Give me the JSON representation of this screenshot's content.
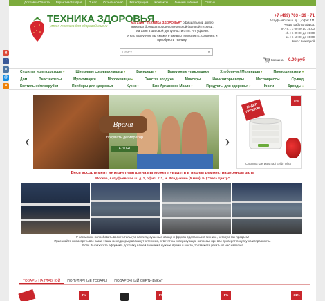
{
  "topnav": [
    "Доставка/Оплата",
    "Гарантия/Возврат",
    "О нас",
    "Отзывы о нас",
    "Регистрация",
    "Контакты",
    "Личный кабинет",
    "Статьи"
  ],
  "brand": {
    "name": "ТЕХНИКА ЗДОРОВЬЯ",
    "tagline": "умная техника для здоровой жизни"
  },
  "header_info": {
    "line1_red": "Магазин \"ТЕХНИКА ЗДОРОВЬЯ\"",
    "line1_rest": " официальный дилер",
    "line2": "мировых брендов профессиональной бытовой техники.",
    "line3": "Магазин в шаговой доступности от м. Алтуфьево.",
    "line4": "У нас в шоуруме вы сможете вживую посмотреть, сравнить и",
    "line5": "приобрести технику."
  },
  "contacts": {
    "phone": "+7 (499) 703 - 39 - 71",
    "address": "Алтуфьевское ш. д. 1, офис 111",
    "hours_title": "Режим работы офиса:",
    "hours": [
      "пн.-пт. : с 09:00 до 19:00",
      "сб. : с 09:00 до 19:00",
      "вс. : с 10:00 до 15:00",
      "вскр.: выходной"
    ]
  },
  "search": {
    "placeholder": "Поиск"
  },
  "cart": {
    "label": "Корзина",
    "price": "0.00 руб"
  },
  "menu_rows": [
    [
      {
        "label": "Сушилки и дегидраторы",
        "drop": true
      },
      {
        "label": "Шнековые соковыжималки",
        "drop": true
      },
      {
        "label": "Блендеры",
        "drop": true
      },
      {
        "label": "Вакуумные упаковщики",
        "drop": false
      },
      {
        "label": "Хлебопечи / Мельницы",
        "drop": true
      },
      {
        "label": "Пророщиватели",
        "drop": true
      }
    ],
    [
      {
        "label": "Дом",
        "drop": false
      },
      {
        "label": "Экостеклеры",
        "drop": false
      },
      {
        "label": "Мультиварки",
        "drop": false
      },
      {
        "label": "Мороженицы",
        "drop": true
      },
      {
        "label": "Очистка воздуха",
        "drop": false
      },
      {
        "label": "Миксеры",
        "drop": false
      },
      {
        "label": "Ионизаторы воды",
        "drop": false
      },
      {
        "label": "Маслопрессы",
        "drop": false
      },
      {
        "label": "Су-вид",
        "drop": false
      }
    ],
    [
      {
        "label": "Коптильни/мясорубки",
        "drop": false
      },
      {
        "label": "Приборы для здоровья",
        "drop": false
      },
      {
        "label": "Кухня",
        "drop": true
      },
      {
        "label": "Био Аргановое Масло",
        "drop": true
      },
      {
        "label": "Продукты для здоровья",
        "drop": true
      },
      {
        "label": "Книги",
        "drop": false
      },
      {
        "label": "Бренды",
        "drop": true
      }
    ]
  ],
  "slider": {
    "title": "Время",
    "subtitle": "покупать дегидратор",
    "brand": "EZIDRI"
  },
  "featured": {
    "badge": "8%",
    "ribbon": "ЛИДЕР ПРОДАЖ!",
    "caption": "Сушилка (Дегидратор) Ezidri Ultra"
  },
  "promo": {
    "line1": "Весь ассортимент интернет-магазина вы можете увидеть в нашем демонстрационном зале",
    "line2": "Москва, Алтуфьевское ш. д. 1, офис: 111, м. Владыкино (5 мин), БЦ \"Бета Центр\""
  },
  "about": [
    "У нас можно попробовать восхитительную пастилу, сушеные овощи и фрукты сделанные в технике, которую мы продаем!",
    "Приезжайте посмотреть все сами. Наши менеджеры расскажут о технике, ответят на интересующие вопросы, при вас проверят покупку на исправность.",
    "Если Вы захотите оформить доставку вашей техники в нужное время и место, то сможете уехать от нас налегке!"
  ],
  "tabs": [
    "ТОВАРЫ НА ГЛАВНОЙ",
    "ПОПУЛЯРНЫЕ ТОВАРЫ",
    "ПОДАРОЧНЫЙ СЕРТИФИКАТ"
  ],
  "cards": [
    {
      "badge": "8%"
    },
    {
      "badge": "8%"
    },
    {
      "badge": "8%"
    },
    {
      "badge": "31%"
    }
  ],
  "colors": {
    "green": "#7cab3c",
    "red": "#c9262c",
    "dark_green": "#2a6b2a"
  }
}
